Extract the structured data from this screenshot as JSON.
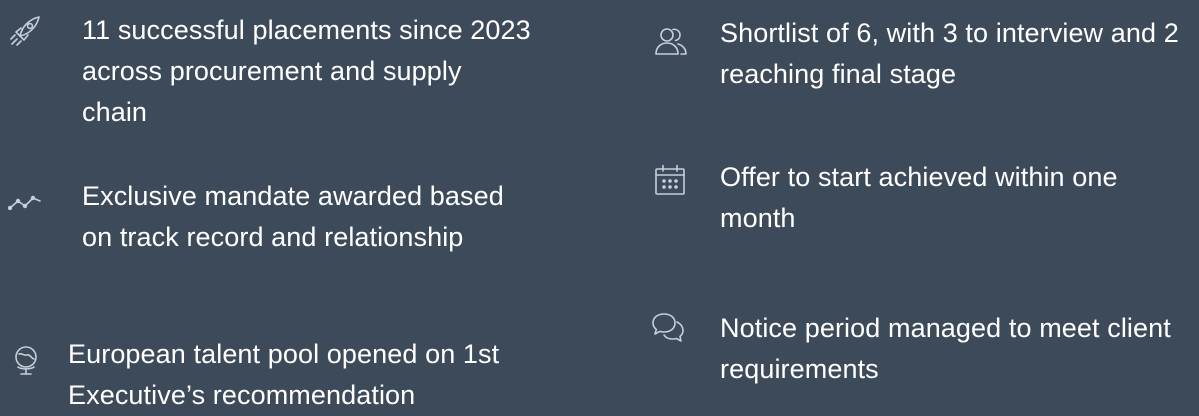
{
  "colors": {
    "background": "#3d4a59",
    "text": "#ffffff",
    "icon": "#c7cfd8"
  },
  "highlights": [
    {
      "icon": "rocket-icon",
      "text": "11 successful placements since 2023 across procurement and supply chain"
    },
    {
      "icon": "trend-line-icon",
      "text": "Exclusive mandate awarded based on track record and relationship"
    },
    {
      "icon": "globe-icon",
      "text": "European talent pool opened on 1st Executive’s recommendation"
    },
    {
      "icon": "people-icon",
      "text": "Shortlist of 6, with 3 to interview and 2 reaching final stage"
    },
    {
      "icon": "calendar-icon",
      "text": "Offer to start achieved within one month"
    },
    {
      "icon": "chat-icon",
      "text": "Notice period managed to meet client requirements"
    }
  ]
}
